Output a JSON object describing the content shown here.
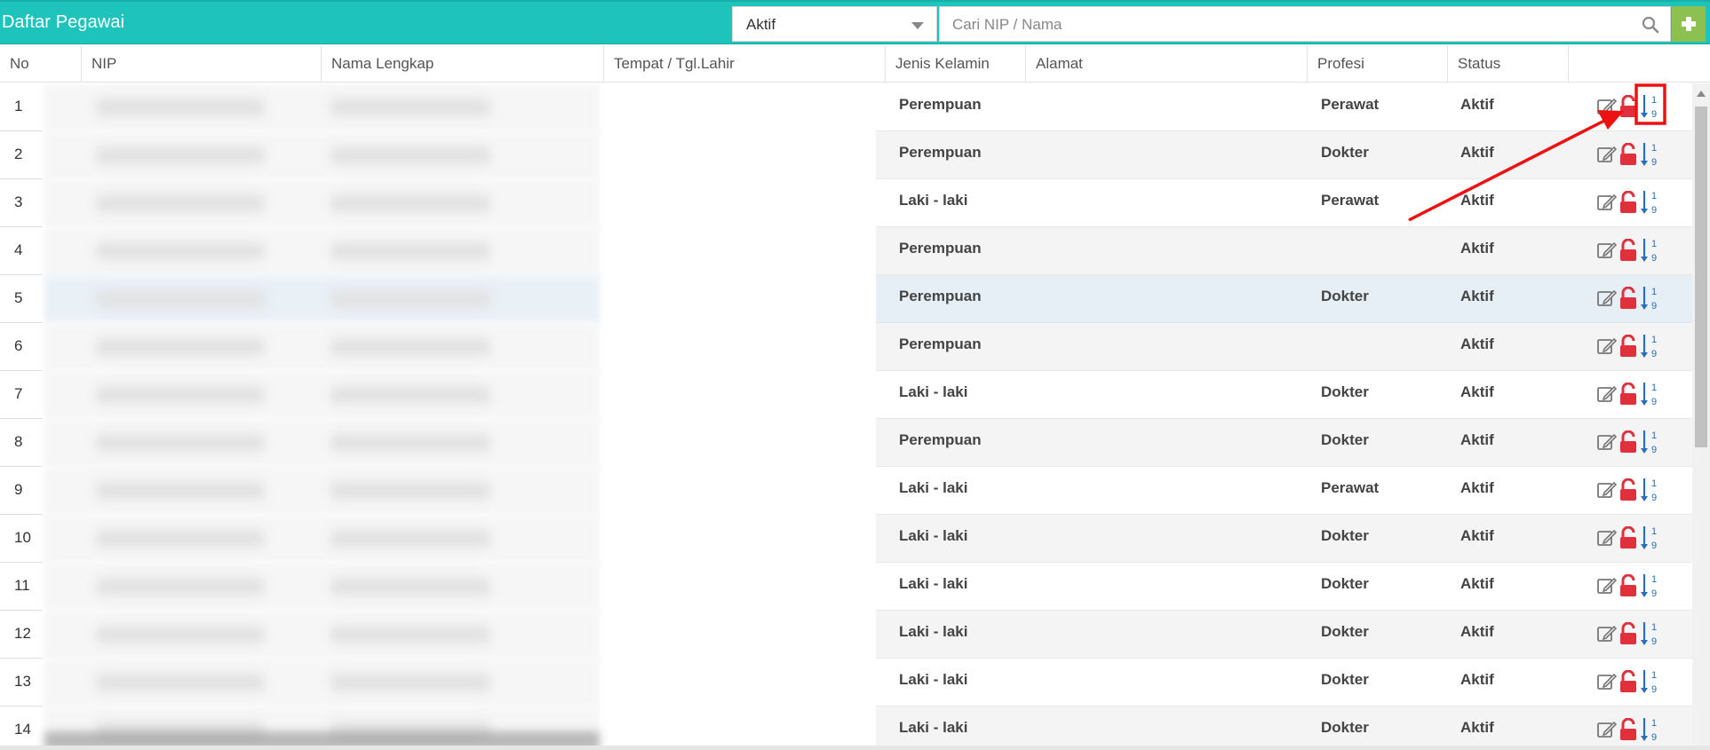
{
  "header": {
    "title": "Daftar Pegawai",
    "status_filter": "Aktif",
    "search_placeholder": "Cari NIP / Nama",
    "add_label": "+"
  },
  "columns": [
    "No",
    "NIP",
    "Nama Lengkap",
    "Tempat / Tgl.Lahir",
    "Jenis Kelamin",
    "Alamat",
    "Profesi",
    "Status"
  ],
  "rows": [
    {
      "no": "1",
      "jenis_kelamin": "Perempuan",
      "profesi": "Perawat",
      "status": "Aktif"
    },
    {
      "no": "2",
      "jenis_kelamin": "Perempuan",
      "profesi": "Dokter",
      "status": "Aktif"
    },
    {
      "no": "3",
      "jenis_kelamin": "Laki - laki",
      "profesi": "Perawat",
      "status": "Aktif"
    },
    {
      "no": "4",
      "jenis_kelamin": "Perempuan",
      "profesi": "",
      "status": "Aktif"
    },
    {
      "no": "5",
      "jenis_kelamin": "Perempuan",
      "profesi": "Dokter",
      "status": "Aktif"
    },
    {
      "no": "6",
      "jenis_kelamin": "Perempuan",
      "profesi": "",
      "status": "Aktif"
    },
    {
      "no": "7",
      "jenis_kelamin": "Laki - laki",
      "profesi": "Dokter",
      "status": "Aktif"
    },
    {
      "no": "8",
      "jenis_kelamin": "Perempuan",
      "profesi": "Dokter",
      "status": "Aktif"
    },
    {
      "no": "9",
      "jenis_kelamin": "Laki - laki",
      "profesi": "Perawat",
      "status": "Aktif"
    },
    {
      "no": "10",
      "jenis_kelamin": "Laki - laki",
      "profesi": "Dokter",
      "status": "Aktif"
    },
    {
      "no": "11",
      "jenis_kelamin": "Laki - laki",
      "profesi": "Dokter",
      "status": "Aktif"
    },
    {
      "no": "12",
      "jenis_kelamin": "Laki - laki",
      "profesi": "Dokter",
      "status": "Aktif"
    },
    {
      "no": "13",
      "jenis_kelamin": "Laki - laki",
      "profesi": "Dokter",
      "status": "Aktif"
    },
    {
      "no": "14",
      "jenis_kelamin": "Laki - laki",
      "profesi": "Dokter",
      "status": "Aktif"
    }
  ],
  "row_actions": [
    "edit-icon",
    "unlock-icon",
    "sort-numeric-icon"
  ],
  "colors": {
    "header_bg": "#1ec4bb",
    "add_button": "#8cc152",
    "lock_icon": "#e0303c",
    "sort_icon": "#2a6fb8",
    "highlight": "#ee1111"
  }
}
